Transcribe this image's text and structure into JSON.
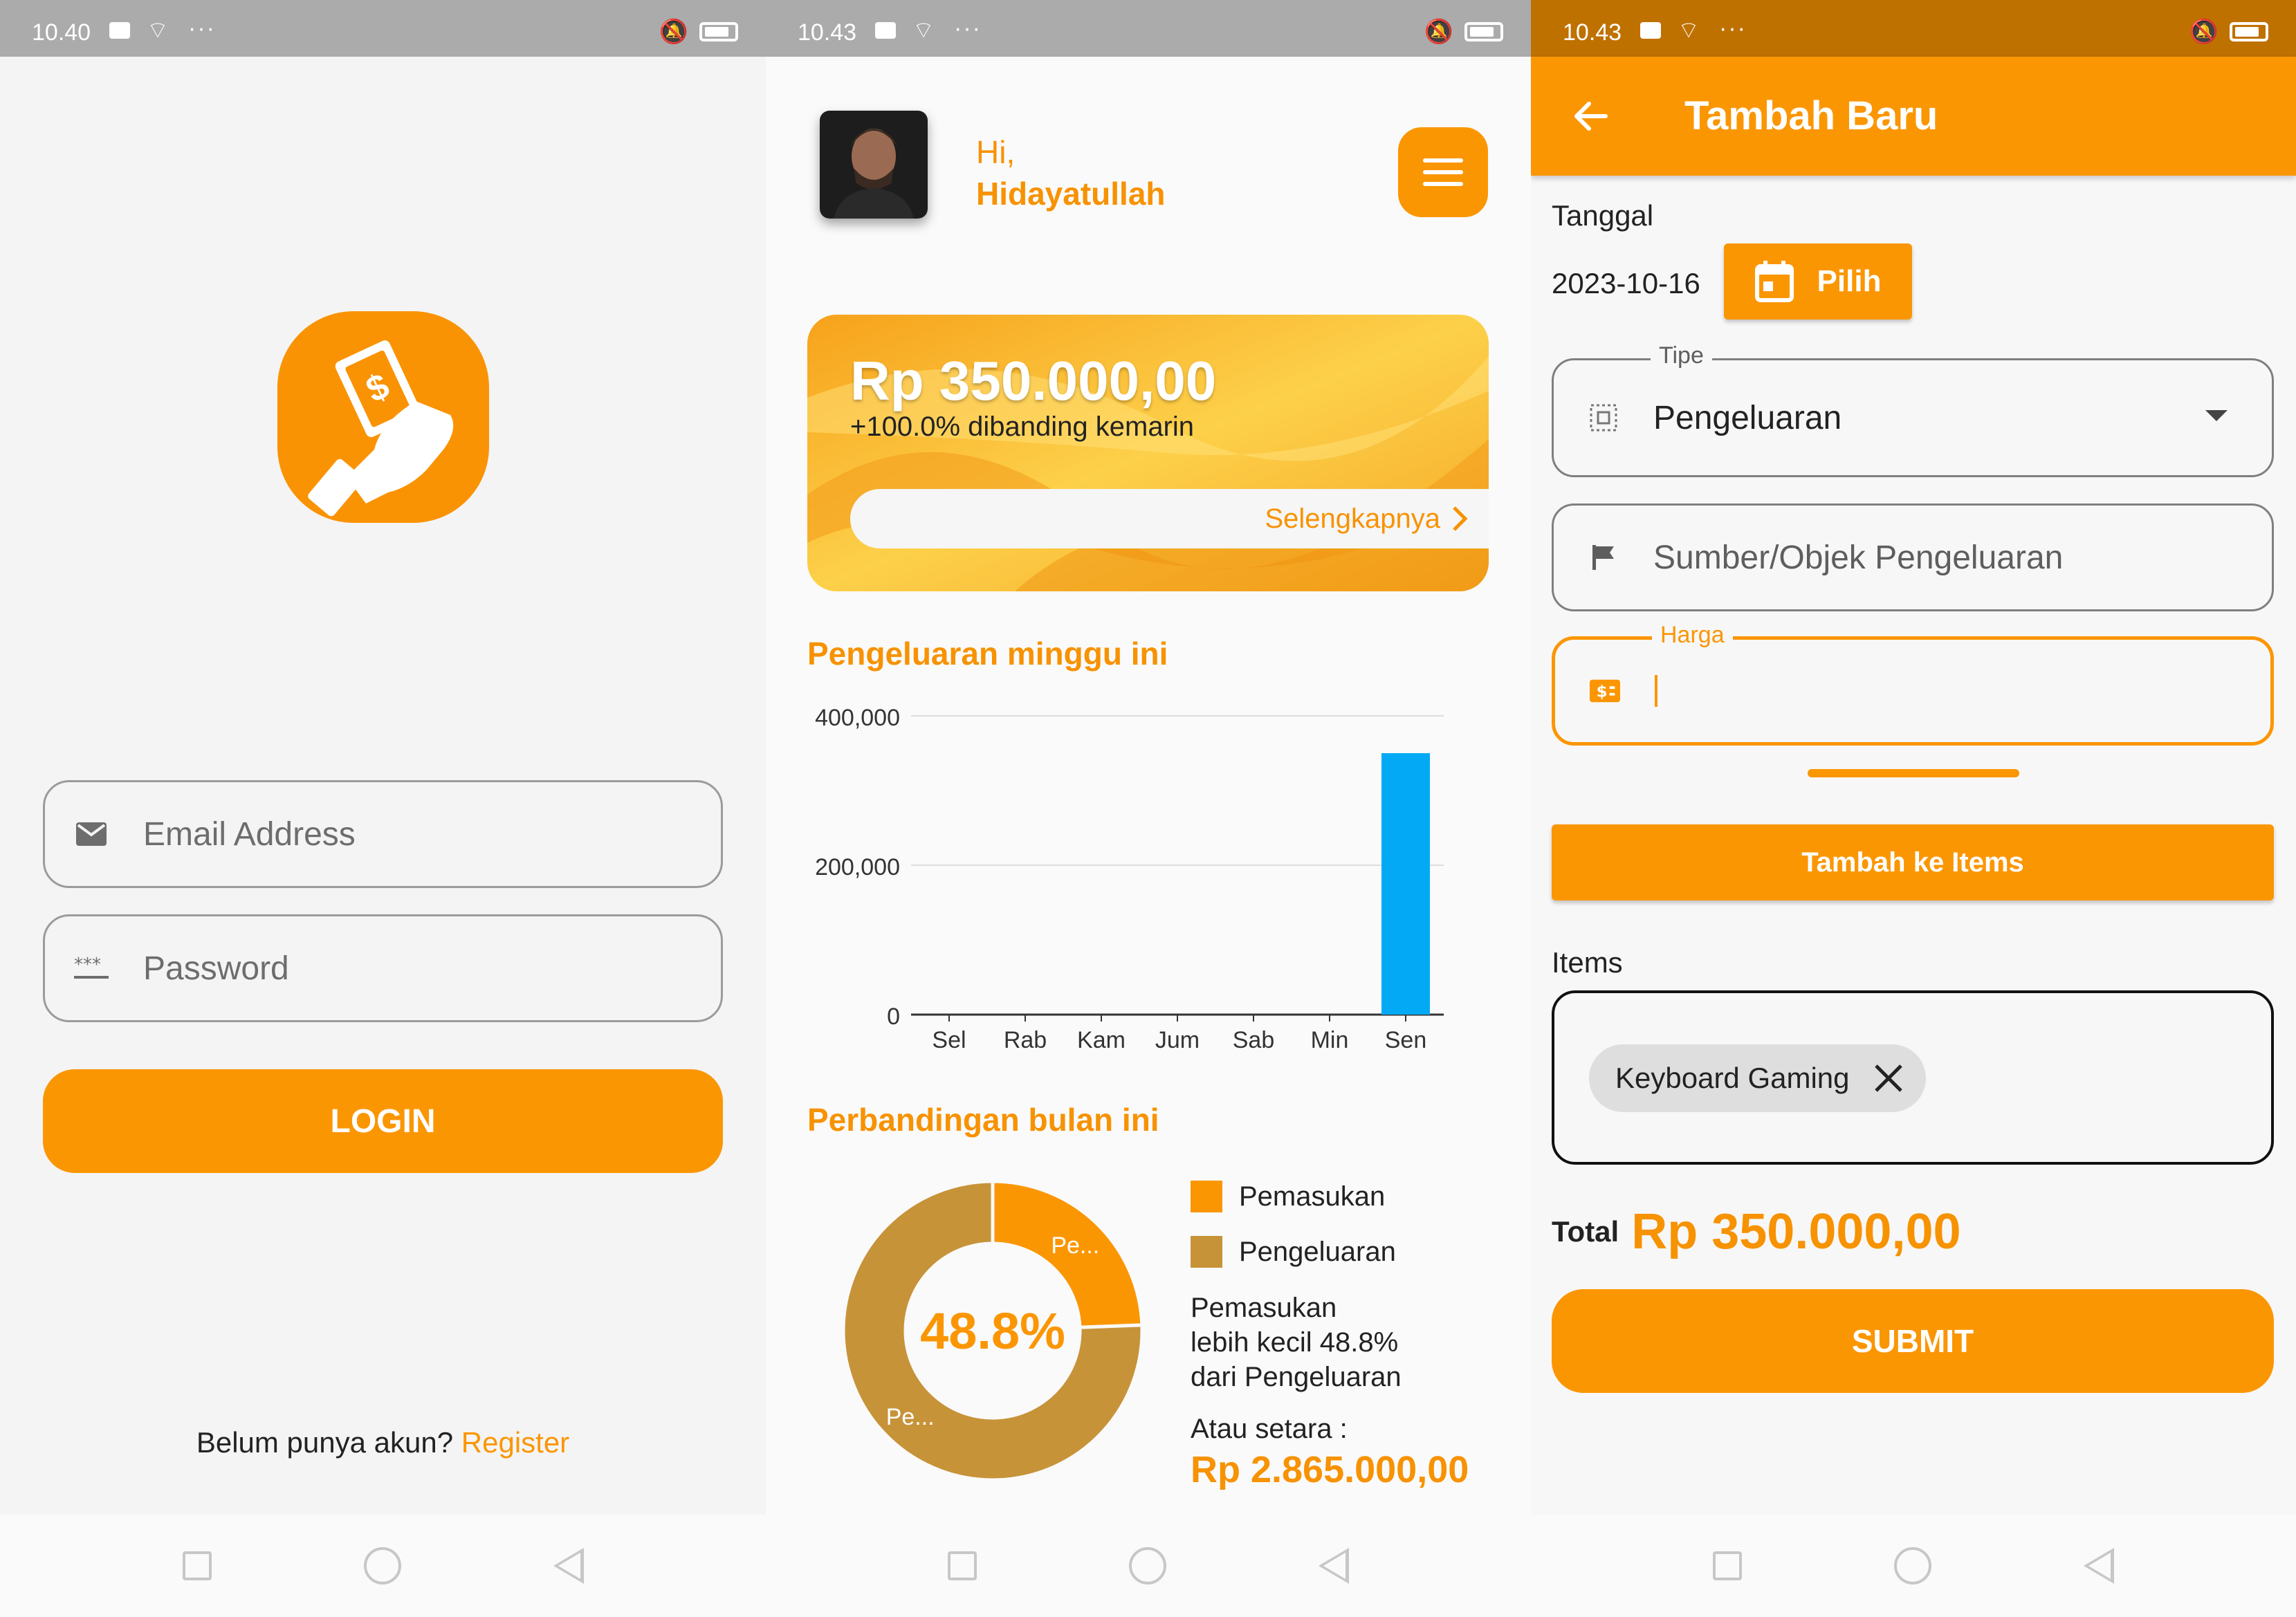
{
  "colors": {
    "accent": "#fb9603",
    "donut_gold": "#c79339",
    "bar_blue": "#03a9f4"
  },
  "login_screen": {
    "status_time": "10.40",
    "email_placeholder": "Email Address",
    "password_placeholder": "Password",
    "login_label": "LOGIN",
    "no_account_text": "Belum punya akun?",
    "register_link": "Register"
  },
  "dashboard_screen": {
    "status_time": "10.43",
    "greeting": "Hi,",
    "user_name": "Hidayatullah",
    "balance": "Rp 350.000,00",
    "comparison_text": "+100.0% dibanding kemarin",
    "more_link": "Selengkapnya",
    "weekly_title": "Pengeluaran minggu ini",
    "monthly_title": "Perbandingan bulan ini",
    "donut_center": "48.8%",
    "donut_label_income": "Pe...",
    "donut_label_expense": "Pe...",
    "legend": [
      "Pemasukan",
      "Pengeluaran"
    ],
    "note_lines": [
      "Pemasukan",
      "lebih kecil 48.8%",
      "dari Pengeluaran"
    ],
    "equivalent_label": "Atau setara :",
    "equivalent_value": "Rp 2.865.000,00"
  },
  "chart_data": [
    {
      "type": "bar",
      "title": "Pengeluaran minggu ini",
      "categories": [
        "Sel",
        "Rab",
        "Kam",
        "Jum",
        "Sab",
        "Min",
        "Sen"
      ],
      "values": [
        0,
        0,
        0,
        0,
        0,
        0,
        350000
      ],
      "yticks": [
        "400,000",
        "200,000",
        "0"
      ],
      "ylim": [
        0,
        400000
      ],
      "grid": true
    },
    {
      "type": "pie",
      "title": "Perbandingan bulan ini",
      "labels": [
        "Pemasukan",
        "Pengeluaran"
      ],
      "values": [
        24.4,
        75.6
      ],
      "center_text": "48.8%"
    }
  ],
  "add_screen": {
    "status_time": "10.43",
    "title": "Tambah Baru",
    "date_label": "Tanggal",
    "date_value": "2023-10-16",
    "pick_button": "Pilih",
    "type_legend": "Tipe",
    "type_value": "Pengeluaran",
    "source_placeholder": "Sumber/Objek Pengeluaran",
    "price_legend": "Harga",
    "add_item_button": "Tambah ke Items",
    "items_label": "Items",
    "items": [
      "Keyboard Gaming"
    ],
    "total_label": "Total",
    "total_value": "Rp 350.000,00",
    "submit_label": "SUBMIT"
  }
}
